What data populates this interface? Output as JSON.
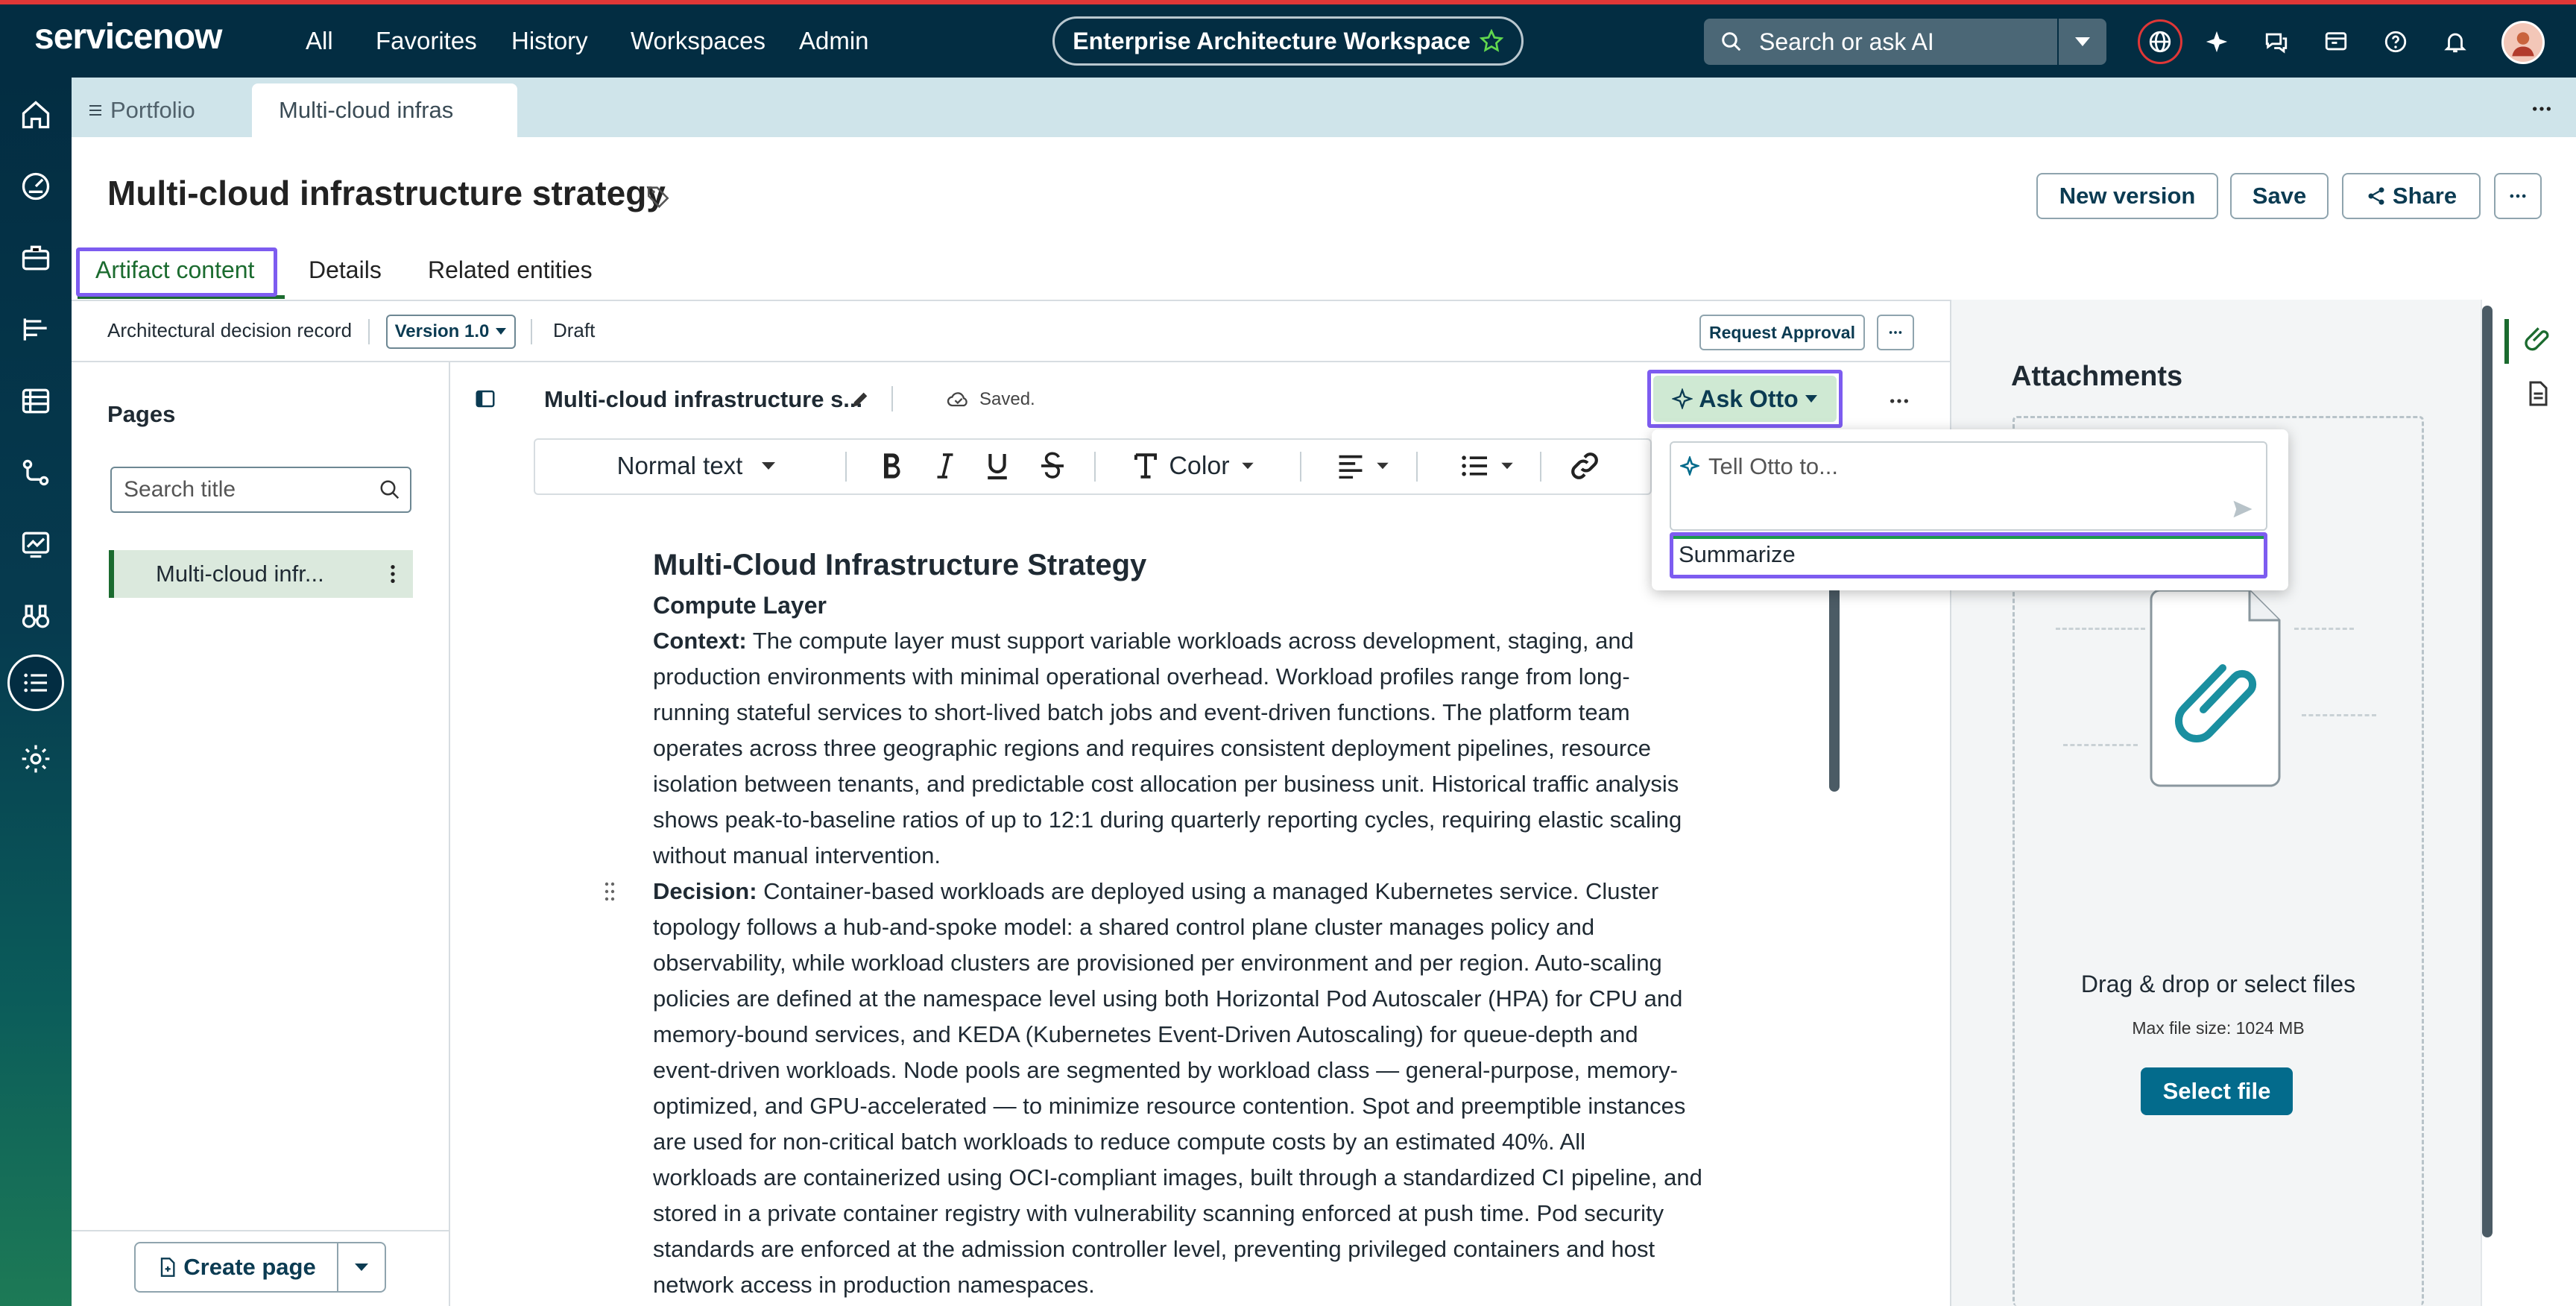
{
  "app": {
    "logo": "servicenow",
    "nav": [
      "All",
      "Favorites",
      "History",
      "Workspaces",
      "Admin"
    ],
    "workspace_title": "Enterprise Architecture Workspace",
    "search_placeholder": "Search or ask AI"
  },
  "tabs": [
    {
      "label": "Portfolio"
    },
    {
      "label": "Multi-cloud infras"
    }
  ],
  "header": {
    "title": "Multi-cloud infrastructure strategy",
    "new_version": "New version",
    "save": "Save",
    "share": "Share"
  },
  "subtabs": [
    "Artifact content",
    "Details",
    "Related entities"
  ],
  "artifact": {
    "type": "Architectural decision record",
    "version": "Version 1.0",
    "status": "Draft",
    "request_approval": "Request Approval"
  },
  "pages": {
    "heading": "Pages",
    "search_placeholder": "Search title",
    "items": [
      "Multi-cloud infr..."
    ],
    "create_page": "Create page"
  },
  "editor": {
    "doc_title": "Multi-cloud infrastructure s...",
    "saved": "Saved.",
    "ask_otto": "Ask Otto",
    "toolbar": {
      "style": "Normal text",
      "color": "Color"
    }
  },
  "otto": {
    "placeholder": "Tell Otto to...",
    "suggestion": "Summarize"
  },
  "document": {
    "h1": "Multi-Cloud Infrastructure Strategy",
    "h2": "Compute Layer",
    "context_label": "Context:",
    "context_lines": [
      " The compute layer must support variable workloads across development, staging, and",
      "production environments with minimal operational overhead. Workload profiles range from long-",
      "running stateful services to short-lived batch jobs and event-driven functions. The platform team",
      "operates across three geographic regions and requires consistent deployment pipelines, resource",
      "isolation between tenants, and predictable cost allocation per business unit. Historical traffic analysis",
      "shows peak-to-baseline ratios of up to 12:1 during quarterly reporting cycles, requiring elastic scaling",
      "without manual intervention."
    ],
    "decision_label": "Decision:",
    "decision_lines": [
      " Container-based workloads are deployed using a managed Kubernetes service. Cluster",
      "topology follows a hub-and-spoke model: a shared control plane cluster manages policy and",
      "observability, while workload clusters are provisioned per environment and per region. Auto-scaling",
      "policies are defined at the namespace level using both Horizontal Pod Autoscaler (HPA) for CPU and",
      "memory-bound services, and KEDA (Kubernetes Event-Driven Autoscaling) for queue-depth and",
      "event-driven workloads. Node pools are segmented by workload class — general-purpose, memory-",
      "optimized, and GPU-accelerated — to minimize resource contention. Spot and preemptible instances",
      "are used for non-critical batch workloads to reduce compute costs by an estimated 40%. All",
      "workloads are containerized using OCI-compliant images, built through a standardized CI pipeline, and",
      "stored in a private container registry with vulnerability scanning enforced at push time. Pod security",
      "standards are enforced at the admission controller level, preventing privileged containers and host",
      "network access in production namespaces."
    ]
  },
  "attachments": {
    "heading": "Attachments",
    "drop_text": "Drag & drop or select files",
    "max_size": "Max file size: 1024 MB",
    "select_button": "Select file"
  },
  "colors": {
    "topbar": "#032d42",
    "accent_red": "#e03737",
    "brand_green": "#62d84e",
    "highlight": "#7d5cf0",
    "primary_button": "#036b8c"
  }
}
